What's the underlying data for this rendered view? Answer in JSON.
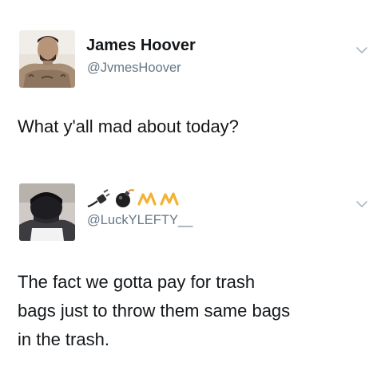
{
  "tweets": [
    {
      "name": "James Hoover",
      "handle": "@JvmesHoover",
      "text": [
        "What y'all mad about today?"
      ],
      "avatar_icon": "profile-photo",
      "menu_icon": "chevron-down-icon"
    },
    {
      "name_emojis": [
        "electric-plug-icon",
        "bomb-icon",
        "signature-m-icon",
        "signature-m-icon"
      ],
      "handle": "@LuckYLEFTY__",
      "text": [
        "The fact we gotta pay for trash",
        "bags just to throw them same bags",
        "in the trash."
      ],
      "avatar_icon": "profile-photo",
      "menu_icon": "chevron-down-icon"
    }
  ],
  "colors": {
    "text": "#14171a",
    "secondary": "#657786",
    "chevron": "#aab8c2",
    "signature": "#f2b233"
  }
}
